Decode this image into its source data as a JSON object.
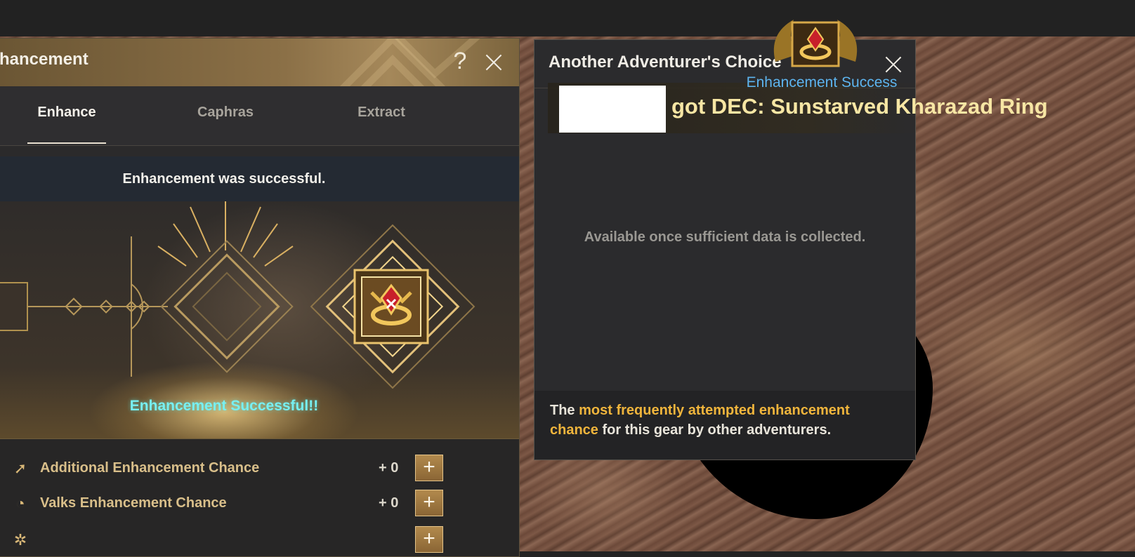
{
  "enhancement_panel": {
    "title": "hancement",
    "help_label": "?",
    "tabs": [
      {
        "label": "Enhance",
        "active": true
      },
      {
        "label": "Caphras",
        "active": false
      },
      {
        "label": "Extract",
        "active": false
      }
    ],
    "status_text": "Enhancement was successful.",
    "success_text": "Enhancement Successful!!",
    "options": [
      {
        "label": "Additional Enhancement Chance",
        "value": "+ 0",
        "icon": "arrow-up-icon"
      },
      {
        "label": "Valks Enhancement Chance",
        "value": "+ 0",
        "icon": "globe-icon"
      }
    ]
  },
  "adventurer_panel": {
    "title": "Another Adventurer's Choice",
    "available_text": "Available once sufficient data is collected.",
    "footer": {
      "prefix": "The ",
      "highlight": "most frequently attempted enhancement chance",
      "suffix": " for this gear by other adventurers."
    }
  },
  "notification": {
    "subtitle": "Enhancement Success",
    "message": "got DEC: Sunstarved Kharazad Ring"
  },
  "colors": {
    "accent_gold": "#f0b53c",
    "success_cyan": "#77f0f2",
    "notification_blue": "#5db4ee"
  }
}
